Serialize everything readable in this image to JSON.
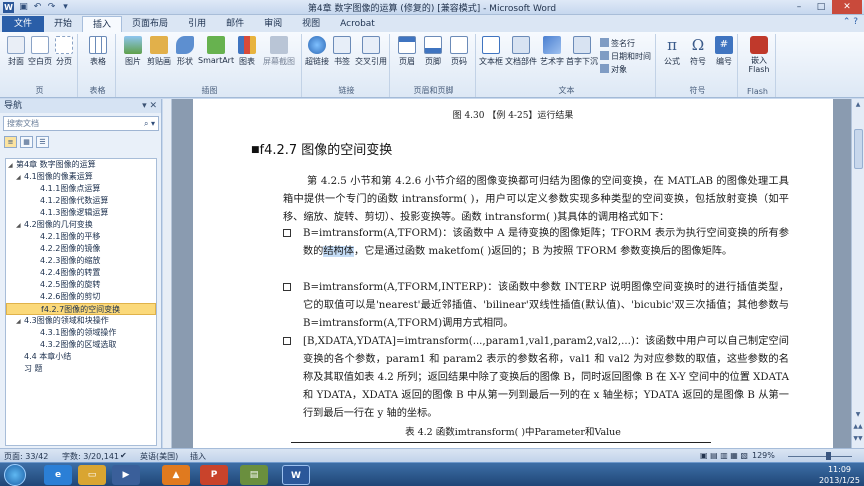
{
  "window": {
    "title": "第4章 数字图像的运算 (修复的) [兼容模式] - Microsoft Word",
    "app_icon": "W"
  },
  "colors": {
    "accent": "#2a5ea8",
    "highlight": "#fbd97a",
    "ribbon_bg": "#dde8f5"
  },
  "ribbon_tabs": [
    "开始",
    "插入",
    "页面布局",
    "引用",
    "邮件",
    "审阅",
    "视图",
    "Acrobat"
  ],
  "file_tab": "文件",
  "active_tab": "插入",
  "ribbon": {
    "pages": {
      "label": "页",
      "buttons": [
        "封面",
        "空白页",
        "分页"
      ]
    },
    "table": {
      "label": "表格",
      "buttons": [
        "表格"
      ]
    },
    "illustrations": {
      "label": "插图",
      "buttons": [
        "图片",
        "剪贴画",
        "形状",
        "SmartArt",
        "图表",
        "屏幕截图"
      ]
    },
    "links": {
      "label": "链接",
      "buttons": [
        "超链接",
        "书签",
        "交叉引用"
      ]
    },
    "header_footer": {
      "label": "页眉和页脚",
      "buttons": [
        "页眉",
        "页脚",
        "页码"
      ]
    },
    "text": {
      "label": "文本",
      "buttons": [
        "文本框",
        "文档部件",
        "艺术字",
        "首字下沉"
      ],
      "small": [
        "签名行",
        "日期和时间",
        "对象"
      ]
    },
    "symbols": {
      "label": "符号",
      "buttons": [
        "公式",
        "符号",
        "编号"
      ]
    },
    "flash": {
      "label": "Flash",
      "buttons": [
        "嵌入\nFlash"
      ]
    }
  },
  "nav": {
    "title": "导航",
    "search_placeholder": "搜索文档",
    "items": [
      {
        "text": "第4章  数字图像的运算",
        "level": 0
      },
      {
        "text": "4.1图像的像素运算",
        "level": 1
      },
      {
        "text": "4.1.1图像点运算",
        "level": 2
      },
      {
        "text": "4.1.2图像代数运算",
        "level": 2
      },
      {
        "text": "4.1.3图像逻辑运算",
        "level": 2
      },
      {
        "text": "4.2图像的几何变换",
        "level": 1
      },
      {
        "text": "4.2.1图像的平移",
        "level": 2
      },
      {
        "text": "4.2.2图像的镜像",
        "level": 2
      },
      {
        "text": "4.2.3图像的缩放",
        "level": 2
      },
      {
        "text": "4.2.4图像的转置",
        "level": 2
      },
      {
        "text": "4.2.5图像的旋转",
        "level": 2
      },
      {
        "text": "4.2.6图像的剪切",
        "level": 2
      },
      {
        "text": "f4.2.7图像的空间变换",
        "level": 2,
        "selected": true
      },
      {
        "text": "4.3图像的领域和块操作",
        "level": 1
      },
      {
        "text": "4.3.1图像的领域操作",
        "level": 2
      },
      {
        "text": "4.3.2图像的区域选取",
        "level": 2
      },
      {
        "text": "4.4  本章小结",
        "level": 1
      },
      {
        "text": "习  题",
        "level": 1
      }
    ]
  },
  "document": {
    "figure_caption": "图 4.30   【例 4-25】运行结果",
    "heading": "f4.2.7 图像的空间变换",
    "intro": "第 4.2.5 小节和第 4.2.6 小节介绍的图像变换都可归结为图像的空间变换，在 MATLAB 的图像处理工具箱中提供一个专门的函数 intransform( )，用户可以定义参数实现多种类型的空间变换，包括放射变换（如平移、缩放、旋转、剪切）、投影变换等。函数 intransform( )其具体的调用格式如下：",
    "bullet1_a": "B=imtransform(A,TFORM)：该函数中 A 是待变换的图像矩阵；TFORM 表示为执行空间变换的所有参数的",
    "bullet1_hl": "结构体",
    "bullet1_b": "，它是通过函数 maketfom( )返回的；B 为按照 TFORM 参数变换后的图像矩阵。",
    "bullet2": "B=imtransform(A,TFORM,INTERP)：该函数中参数 INTERP 说明图像空间变换时的进行插值类型，它的取值可以是'nearest'最近邻插值、'bilinear'双线性插值(默认值)、'bicubic'双三次插值；其他参数与 B=imtransform(A,TFORM)调用方式相同。",
    "bullet3": "[B,XDATA,YDATA]=imtransform(...,param1,val1,param2,val2,...)：该函数中用户可以自己制定空间变换的各个参数，param1 和 param2 表示的参数名称，val1 和 val2 为对应参数的取值，这些参数的名称及其取值如表 4.2 所列；返回结果中除了变换后的图像 B，同时返回图像 B 在 X-Y 空间中的位置 XDATA 和 YDATA，XDATA 返回的图像 B 中从第一列到最后一列的在 x 轴坐标；YDATA 返回的是图像 B 从第一行到最后一行在 y 轴的坐标。",
    "table_caption": "表 4.2  函数imtransform( )中Parameter和Value"
  },
  "status": {
    "page": "页面: 33/42",
    "words": "字数: 3/20,141",
    "lang": "英语(美国)",
    "mode": "插入",
    "zoom": "129%",
    "zoom_fraction": 0.62
  },
  "taskbar": {
    "time": "11:09",
    "date": "2013/1/25"
  }
}
